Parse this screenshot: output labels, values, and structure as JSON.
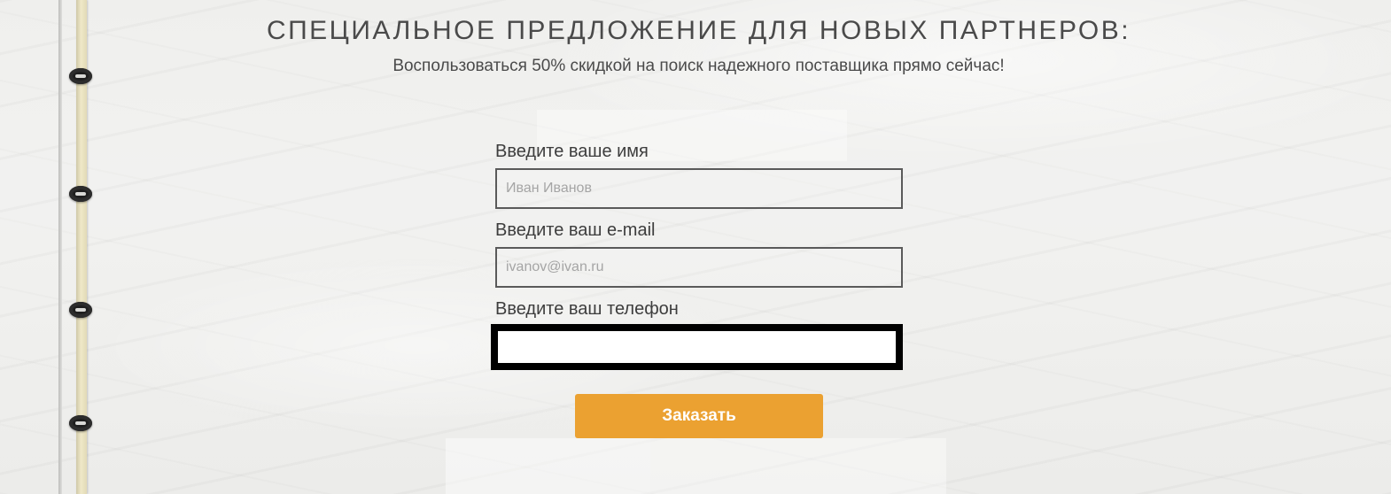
{
  "header": {
    "title": "СПЕЦИАЛЬНОЕ ПРЕДЛОЖЕНИЕ ДЛЯ НОВЫХ ПАРТНЕРОВ:",
    "subtitle": "Воспользоваться 50% скидкой на поиск надежного поставщика прямо сейчас!"
  },
  "form": {
    "name": {
      "label": "Введите ваше имя",
      "placeholder": "Иван Иванов",
      "value": ""
    },
    "email": {
      "label": "Введите ваш e-mail",
      "placeholder": "ivanov@ivan.ru",
      "value": ""
    },
    "phone": {
      "label": "Введите ваш телефон",
      "placeholder": "",
      "value": ""
    },
    "submit_label": "Заказать"
  },
  "colors": {
    "accent": "#eba131",
    "text": "#4a4a4a",
    "field_border": "#5a5a5a",
    "focused_border": "#000000"
  },
  "icons": [
    "binder-ring-icon"
  ]
}
